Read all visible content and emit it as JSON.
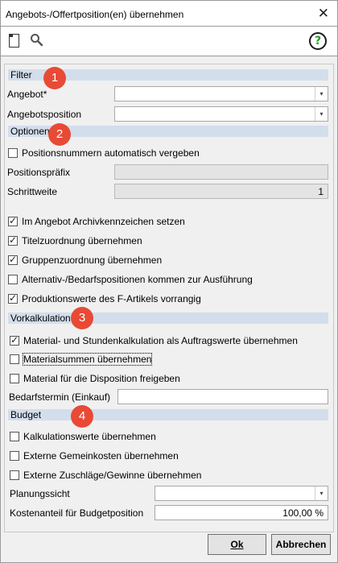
{
  "window": {
    "title": "Angebots-/Offertposition(en) übernehmen",
    "close_glyph": "✕"
  },
  "toolbar": {
    "icons": [
      "new-document-icon",
      "search-icon",
      "help-icon"
    ],
    "help_glyph": "?"
  },
  "badges": [
    "1",
    "2",
    "3",
    "4"
  ],
  "filter": {
    "heading": "Filter",
    "angebot_label": "Angebot*",
    "angebot_value": "",
    "position_label": "Angebotsposition",
    "position_value": ""
  },
  "optionen": {
    "heading": "Optionen",
    "auto_number": {
      "label": "Positionsnummern automatisch vergeben",
      "checked": false
    },
    "prefix_label": "Positionspräfix",
    "prefix_value": "",
    "step_label": "Schrittweite",
    "step_value": "1",
    "checks": [
      {
        "label": "Im Angebot Archivkennzeichen setzen",
        "checked": true
      },
      {
        "label": "Titelzuordnung übernehmen",
        "checked": true
      },
      {
        "label": "Gruppenzuordnung übernehmen",
        "checked": true
      },
      {
        "label": "Alternativ-/Bedarfspositionen kommen zur Ausführung",
        "checked": false
      },
      {
        "label": "Produktionswerte des F-Artikels vorrangig",
        "checked": true
      }
    ]
  },
  "vorkalkulation": {
    "heading": "Vorkalkulation",
    "checks": [
      {
        "label": "Material- und Stundenkalkulation als Auftragswerte übernehmen",
        "checked": true
      },
      {
        "label": "Materialsummen übernehmen",
        "checked": false
      },
      {
        "label": "Material für die Disposition freigeben",
        "checked": false
      }
    ],
    "date_label": "Bedarfstermin (Einkauf)",
    "date_value": ""
  },
  "budget": {
    "heading": "Budget",
    "checks": [
      {
        "label": "Kalkulationswerte übernehmen",
        "checked": false
      },
      {
        "label": "Externe Gemeinkosten übernehmen",
        "checked": false
      },
      {
        "label": "Externe Zuschläge/Gewinne übernehmen",
        "checked": false
      }
    ],
    "view_label": "Planungssicht",
    "view_value": "",
    "share_label": "Kostenanteil für Budgetposition",
    "share_value": "100,00 %"
  },
  "buttons": {
    "ok": "Ok",
    "cancel": "Abbrechen"
  },
  "colors": {
    "section_band": "#d3deec",
    "badge": "#e84a35",
    "help_mark": "#1f9d1f"
  }
}
